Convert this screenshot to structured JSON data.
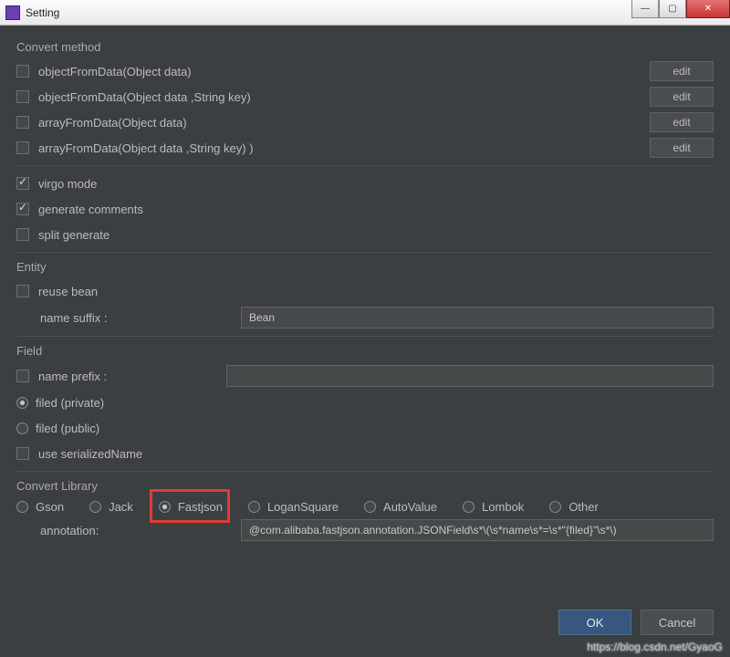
{
  "window": {
    "title": "Setting"
  },
  "winbuttons": {
    "min": "—",
    "max": "▢",
    "close_icon": "✕"
  },
  "sections": {
    "convert_method": {
      "label": "Convert method",
      "items": [
        {
          "label": "objectFromData(Object data)",
          "checked": false
        },
        {
          "label": "objectFromData(Object data ,String key)",
          "checked": false
        },
        {
          "label": "arrayFromData(Object data)",
          "checked": false
        },
        {
          "label": "arrayFromData(Object data ,String key) )",
          "checked": false
        }
      ],
      "edit_label": "edit"
    },
    "options": {
      "virgo_mode": {
        "label": "virgo mode",
        "checked": true
      },
      "generate_comments": {
        "label": "generate comments",
        "checked": true
      },
      "split_generate": {
        "label": "split generate",
        "checked": false
      }
    },
    "entity": {
      "label": "Entity",
      "reuse_bean": {
        "label": "reuse bean",
        "checked": false
      },
      "name_suffix_label": "name suffix :",
      "name_suffix_value": "Bean"
    },
    "field": {
      "label": "Field",
      "name_prefix": {
        "label": "name prefix :",
        "checked": false,
        "value": ""
      },
      "private": {
        "label": "filed (private)",
        "checked": true
      },
      "public": {
        "label": "filed (public)",
        "checked": false
      },
      "use_serialized": {
        "label": "use serializedName",
        "checked": false
      }
    },
    "library": {
      "label": "Convert Library",
      "options": [
        "Gson",
        "Jack",
        "Fastjson",
        "LoganSquare",
        "AutoValue",
        "Lombok",
        "Other"
      ],
      "selected": "Fastjson",
      "annotation_label": "annotation:",
      "annotation_value": "@com.alibaba.fastjson.annotation.JSONField\\s*\\(\\s*name\\s*=\\s*\"{filed}\"\\s*\\)"
    }
  },
  "buttons": {
    "ok": "OK",
    "cancel": "Cancel"
  },
  "watermark": "https://blog.csdn.net/GyaoG"
}
